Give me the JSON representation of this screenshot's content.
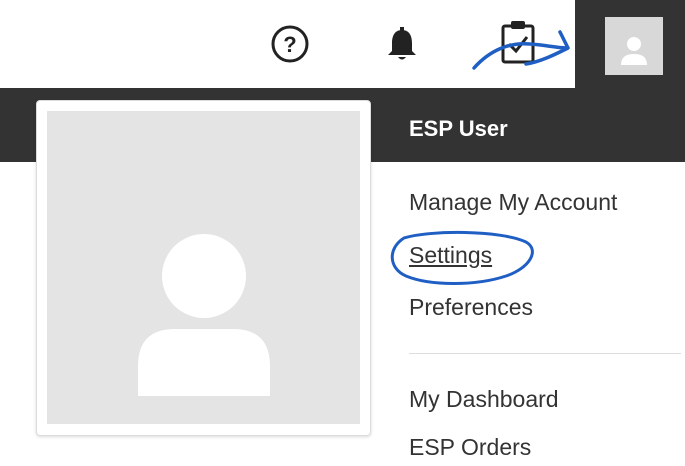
{
  "header": {
    "icons": [
      "help-icon",
      "bell-icon",
      "tasks-icon",
      "avatar-icon"
    ]
  },
  "user_menu": {
    "username": "ESP User",
    "items": [
      {
        "label": "Manage My Account"
      },
      {
        "label": "Settings"
      },
      {
        "label": "Preferences"
      },
      {
        "label": "My Dashboard"
      },
      {
        "label": "ESP Orders"
      }
    ]
  },
  "colors": {
    "dark_band": "#333333",
    "avatar_placeholder": "#e4e4e4",
    "annotation_ink": "#1f5fc4"
  }
}
